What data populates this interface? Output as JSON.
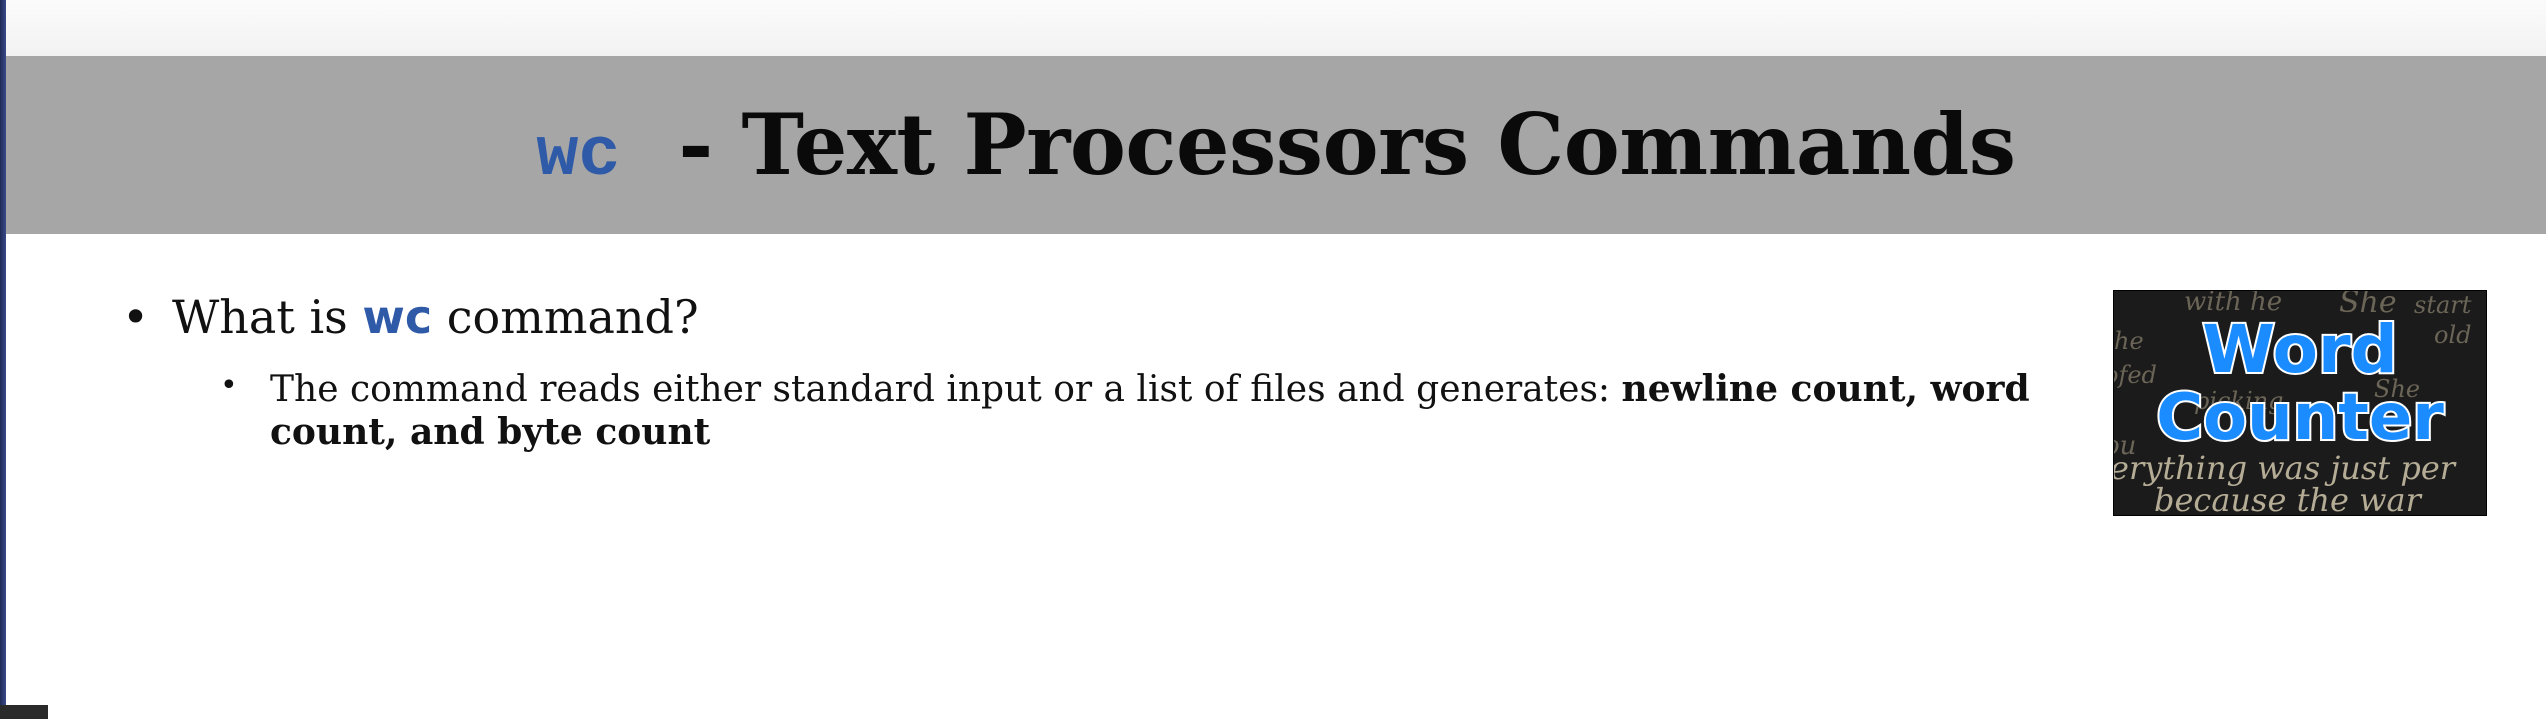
{
  "slide": {
    "title_cmd": "wc",
    "title_text": "- Text Processors Commands",
    "bullet1": {
      "prefix": "What is",
      "cmd": "wc",
      "suffix": "command?"
    },
    "bullet2": {
      "text": "The command reads either standard input or a list of files and generates:",
      "bold_text": "newline count, word count, and byte count"
    },
    "thumbnail": {
      "word1": "Word",
      "word2": "Counter",
      "background_text": [
        "with he",
        "She",
        "start",
        "old",
        "ofed",
        "he",
        "She",
        "picking",
        "ou",
        "erything was just per",
        "because the war"
      ]
    }
  },
  "colors": {
    "title_band": "#a6a6a6",
    "command_blue": "#2e5aa8",
    "thumbnail_blue": "#1a8cff"
  },
  "icons": [
    "bullet-dot-icon"
  ]
}
